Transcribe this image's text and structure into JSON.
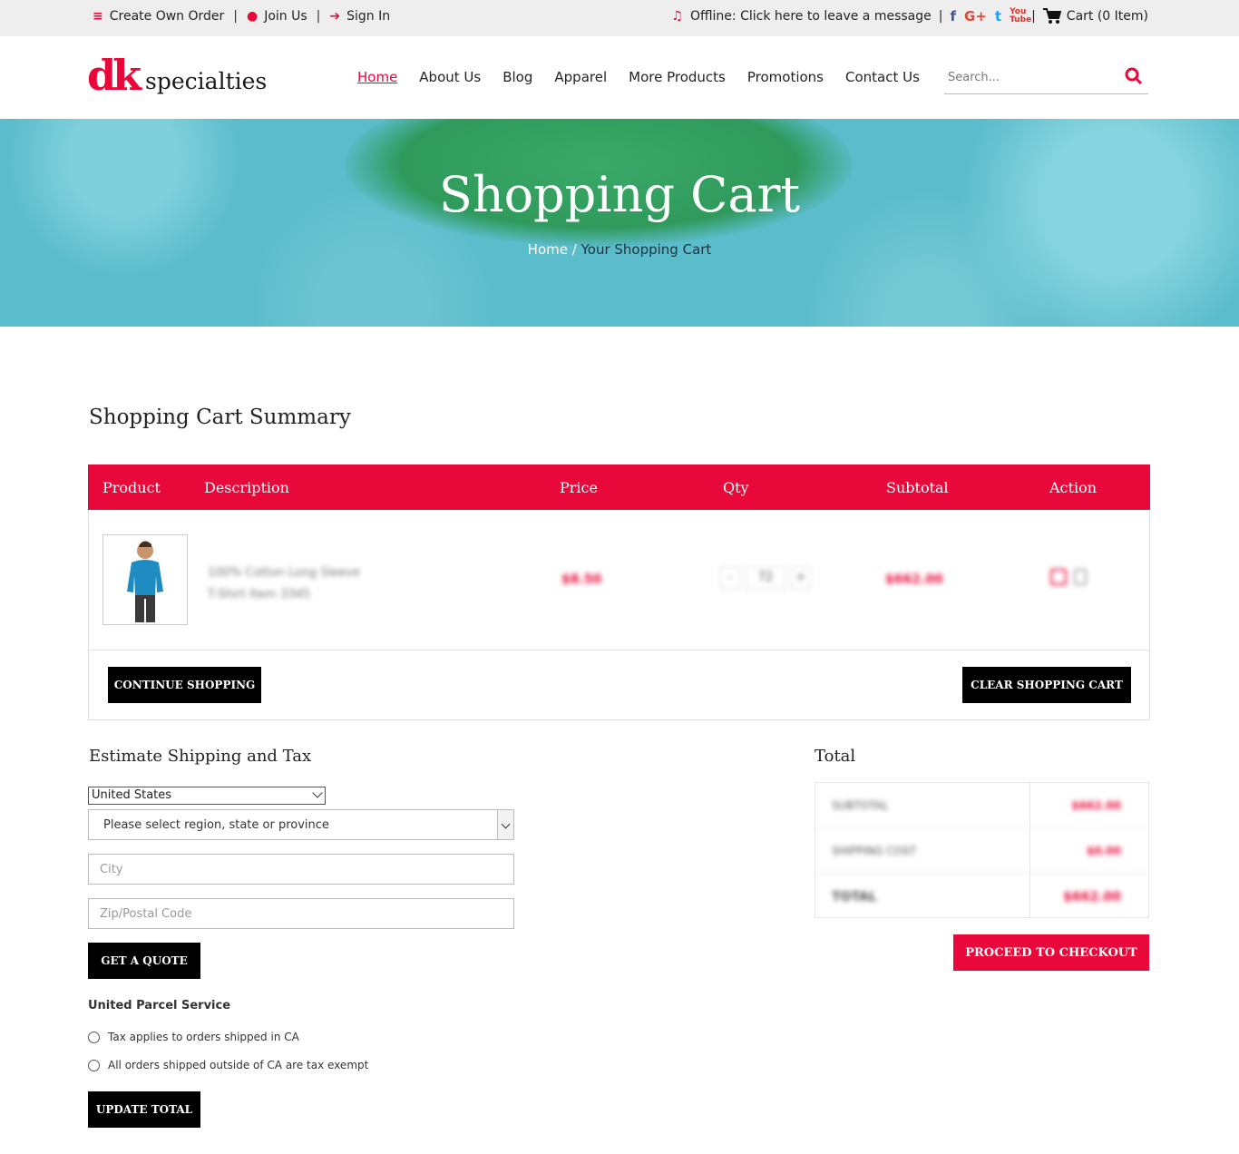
{
  "topbar": {
    "create_order": "Create Own Order",
    "join_us": "Join Us",
    "sign_in": "Sign In",
    "offline": "Offline: Click here to leave a message",
    "cart": "Cart (0 Item)",
    "social": {
      "facebook": "f",
      "google_plus": "G+",
      "twitter": "t",
      "youtube": "You Tube"
    }
  },
  "header": {
    "logo_dk": "dk",
    "logo_text": "specialties",
    "nav": [
      "Home",
      "About Us",
      "Blog",
      "Apparel",
      "More Products",
      "Promotions",
      "Contact Us"
    ],
    "active_nav": "Home",
    "search_placeholder": "Search..."
  },
  "hero": {
    "title": "Shopping Cart",
    "breadcrumb_home": "Home",
    "breadcrumb_sep": "/",
    "breadcrumb_current": "Your Shopping Cart"
  },
  "cart": {
    "title": "Shopping Cart Summary",
    "headers": [
      "Product",
      "Description",
      "Price",
      "Qty",
      "Subtotal",
      "Action"
    ],
    "item": {
      "desc_line1": "100% Cotton Long Sleeve",
      "desc_line2": "T-Shirt Item 3345",
      "price": "$8.50",
      "qty_minus": "-",
      "qty": "72",
      "qty_plus": "+",
      "subtotal": "$662.00"
    },
    "continue_shopping": "CONTINUE SHOPPING",
    "clear_cart": "CLEAR SHOPPING CART"
  },
  "shipping": {
    "title": "Estimate Shipping and Tax",
    "country": "United States",
    "region_placeholder": "Please select region, state or province",
    "city_placeholder": "City",
    "zip_placeholder": "Zip/Postal Code",
    "get_quote": "GET A QUOTE",
    "carrier": "United Parcel Service",
    "option1": "Tax applies to orders shipped in CA",
    "option2": "All orders shipped outside of CA are tax exempt",
    "update_total": "UPDATE TOTAL"
  },
  "total": {
    "title": "Total",
    "rows": [
      {
        "label": "SUBTOTAL",
        "value": "$662.00"
      },
      {
        "label": "SHIPPING COST",
        "value": "$0.00"
      },
      {
        "label": "TOTAL",
        "value": "$662.00"
      }
    ],
    "checkout": "PROCEED TO CHECKOUT"
  },
  "colors": {
    "accent": "#e8083a",
    "topbar_bg": "#eeeeee",
    "button_dark": "#000000"
  }
}
